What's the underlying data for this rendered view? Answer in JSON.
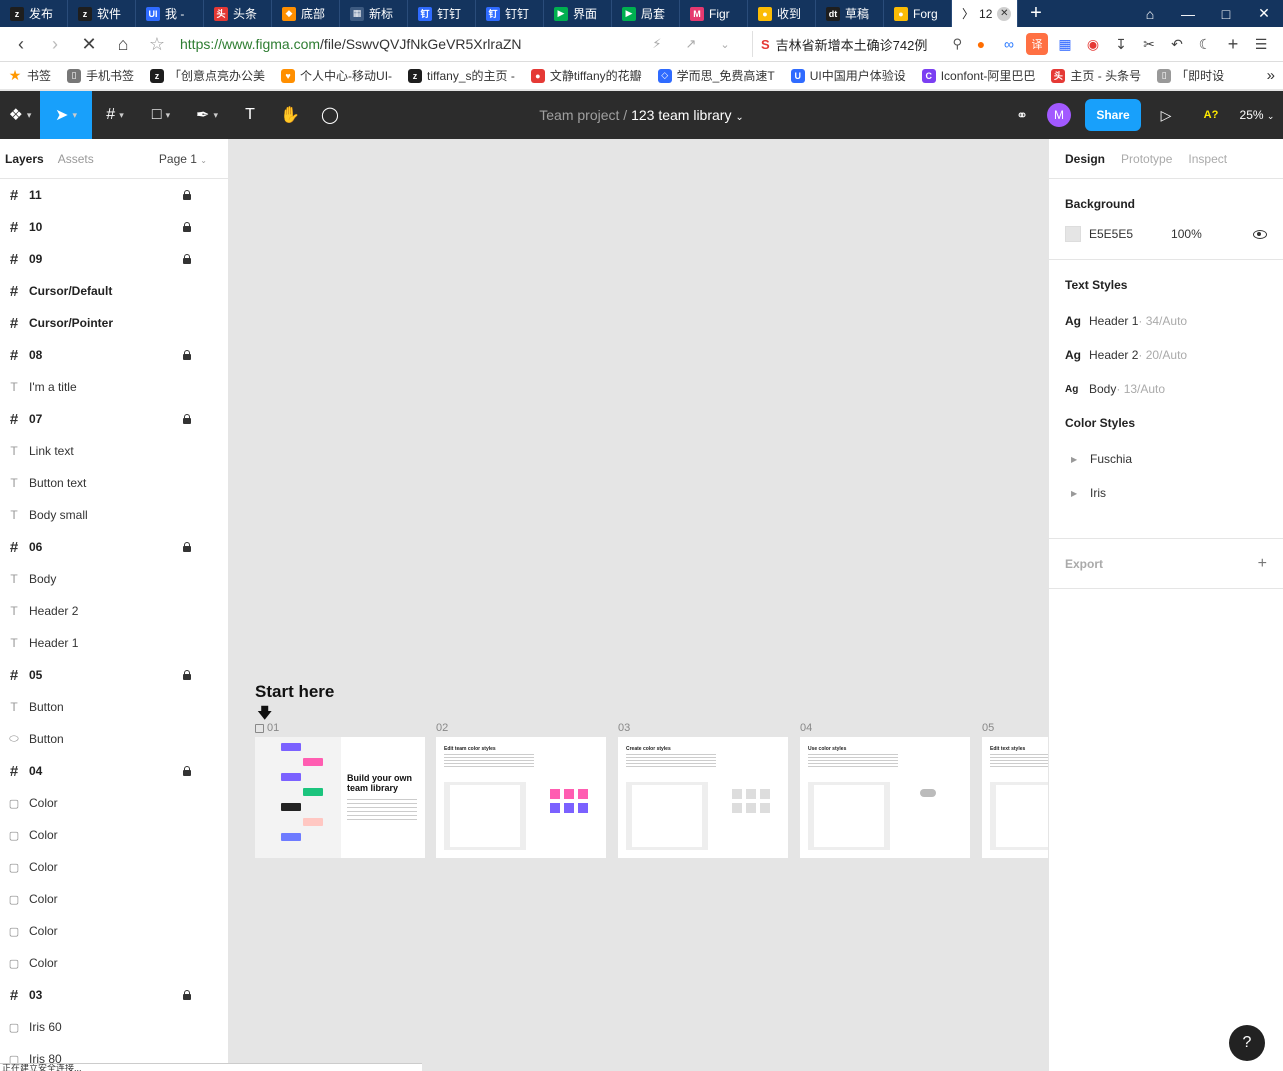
{
  "browser": {
    "tabs": [
      {
        "label": "发布",
        "icon": "z",
        "color": "#1e1e1e"
      },
      {
        "label": "软件",
        "icon": "z",
        "color": "#1e1e1e"
      },
      {
        "label": "我 -",
        "icon": "UI",
        "color": "#2f6bff"
      },
      {
        "label": "头条",
        "icon": "头",
        "color": "#e53935"
      },
      {
        "label": "底部",
        "icon": "◆",
        "color": "#ff8f00"
      },
      {
        "label": "新标",
        "icon": "▦",
        "color": "#3d5a80"
      },
      {
        "label": "钉钉",
        "icon": "钉",
        "color": "#2f6bff"
      },
      {
        "label": "钉钉",
        "icon": "钉",
        "color": "#2f6bff"
      },
      {
        "label": "界面",
        "icon": "▶",
        "color": "#00b050"
      },
      {
        "label": "局套",
        "icon": "▶",
        "color": "#00b050"
      },
      {
        "label": "Figr",
        "icon": "M",
        "color": "#e53970"
      },
      {
        "label": "收到",
        "icon": "●",
        "color": "#fbbc05"
      },
      {
        "label": "草稿",
        "icon": "dt",
        "color": "#1e1e1e"
      },
      {
        "label": "Forg",
        "icon": "●",
        "color": "#fbbc05"
      }
    ],
    "active_tab": {
      "label": "12",
      "icon": "〉"
    },
    "url_scheme_host": "https://www.figma.com",
    "url_path": "/file/SswvQVJfNkGeVR5XrlraZN",
    "search_text": "吉林省新增本土确诊742例",
    "bookmarks": [
      {
        "label": "书签",
        "icon": "★",
        "color": "#ff9800"
      },
      {
        "label": "手机书签",
        "icon": "▯",
        "color": "#777777"
      },
      {
        "label": "「创意点亮办公美",
        "icon": "z",
        "color": "#1e1e1e"
      },
      {
        "label": "个人中心-移动UI-",
        "icon": "♥",
        "color": "#ff8f00"
      },
      {
        "label": "tiffany_s的主页 -",
        "icon": "z",
        "color": "#1e1e1e"
      },
      {
        "label": "文静tiffany的花瓣",
        "icon": "●",
        "color": "#e53935"
      },
      {
        "label": "学而思_免费高速T",
        "icon": "◇",
        "color": "#2f6bff"
      },
      {
        "label": "UI中国用户体验设",
        "icon": "U",
        "color": "#2f6bff"
      },
      {
        "label": "Iconfont-阿里巴巴",
        "icon": "C",
        "color": "#7b3ff2"
      },
      {
        "label": "主页 - 头条号",
        "icon": "头",
        "color": "#e53935"
      },
      {
        "label": "「即时设",
        "icon": "▯",
        "color": "#999999"
      }
    ]
  },
  "figma": {
    "project": "Team project",
    "separator": "/",
    "file_name": "123 team library",
    "avatar_initial": "M",
    "share_label": "Share",
    "missing_fonts": "A?",
    "zoom": "25%"
  },
  "layers_panel": {
    "tabs": [
      "Layers",
      "Assets"
    ],
    "page": "Page 1",
    "items": [
      {
        "name": "11",
        "type": "frame",
        "locked": true
      },
      {
        "name": "10",
        "type": "frame",
        "locked": true
      },
      {
        "name": "09",
        "type": "frame",
        "locked": true
      },
      {
        "name": "Cursor/Default",
        "type": "frame",
        "locked": false
      },
      {
        "name": "Cursor/Pointer",
        "type": "frame",
        "locked": false
      },
      {
        "name": "08",
        "type": "frame",
        "locked": true
      },
      {
        "name": "I'm a title",
        "type": "text",
        "locked": false
      },
      {
        "name": "07",
        "type": "frame",
        "locked": true
      },
      {
        "name": "Link text",
        "type": "text",
        "locked": false
      },
      {
        "name": "Button text",
        "type": "text",
        "locked": false
      },
      {
        "name": "Body small",
        "type": "text",
        "locked": false
      },
      {
        "name": "06",
        "type": "frame",
        "locked": true
      },
      {
        "name": "Body",
        "type": "text",
        "locked": false
      },
      {
        "name": "Header 2",
        "type": "text",
        "locked": false
      },
      {
        "name": "Header 1",
        "type": "text",
        "locked": false
      },
      {
        "name": "05",
        "type": "frame",
        "locked": true
      },
      {
        "name": "Button",
        "type": "text",
        "locked": false
      },
      {
        "name": "Button",
        "type": "ellipse",
        "locked": false
      },
      {
        "name": "04",
        "type": "frame",
        "locked": true
      },
      {
        "name": "Color",
        "type": "rect",
        "locked": false
      },
      {
        "name": "Color",
        "type": "rect",
        "locked": false
      },
      {
        "name": "Color",
        "type": "rect",
        "locked": false
      },
      {
        "name": "Color",
        "type": "rect",
        "locked": false
      },
      {
        "name": "Color",
        "type": "rect",
        "locked": false
      },
      {
        "name": "Color",
        "type": "rect",
        "locked": false
      },
      {
        "name": "03",
        "type": "frame",
        "locked": true
      },
      {
        "name": "Iris 60",
        "type": "rect",
        "locked": false
      },
      {
        "name": "Iris 80",
        "type": "rect",
        "locked": false
      }
    ]
  },
  "canvas": {
    "start_title": "Start here",
    "frames": [
      {
        "label": "01",
        "heading": "Build your own team library"
      },
      {
        "label": "02",
        "heading": "Edit team color styles"
      },
      {
        "label": "03",
        "heading": "Create color styles"
      },
      {
        "label": "04",
        "heading": "Use color styles"
      },
      {
        "label": "05",
        "heading": "Edit text styles"
      }
    ]
  },
  "design_panel": {
    "tabs": [
      "Design",
      "Prototype",
      "Inspect"
    ],
    "background_title": "Background",
    "background_hex": "E5E5E5",
    "background_opacity": "100%",
    "text_styles_title": "Text Styles",
    "text_styles": [
      {
        "ag": "Ag",
        "name": "Header 1",
        "meta": " · 34/Auto"
      },
      {
        "ag": "Ag",
        "name": "Header 2",
        "meta": " · 20/Auto"
      },
      {
        "ag": "Ag",
        "name": "Body",
        "meta": " · 13/Auto"
      }
    ],
    "color_styles_title": "Color Styles",
    "color_styles": [
      "Fuschia",
      "Iris"
    ],
    "export_title": "Export",
    "help": "?"
  },
  "status_text": "正在建立安全连接..."
}
